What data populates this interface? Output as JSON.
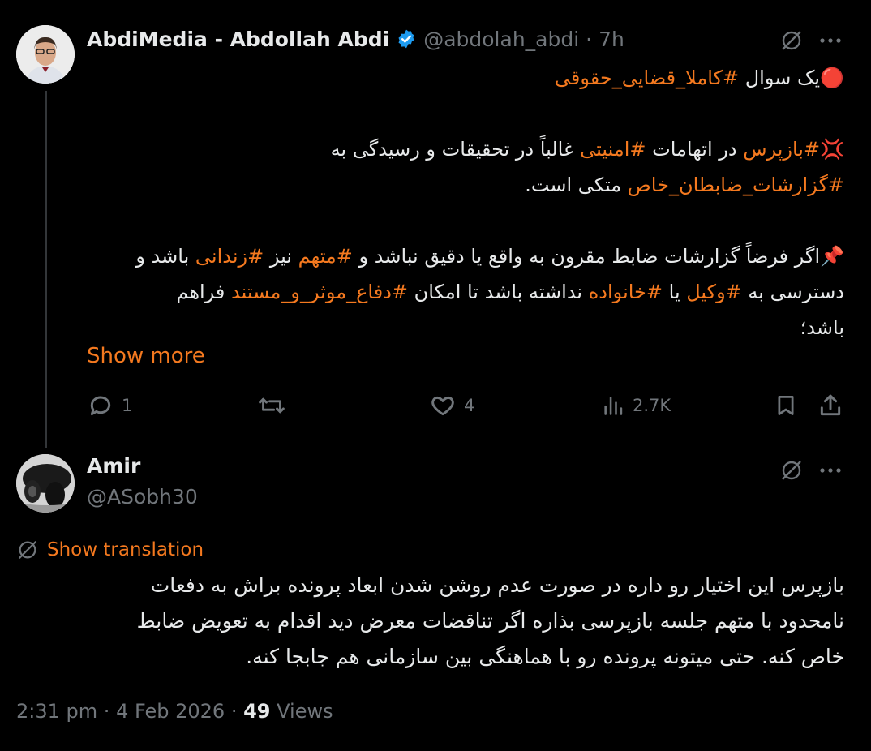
{
  "tweet": {
    "display_name": "AbdiMedia - Abdollah Abdi",
    "handle": "@abdolah_abdi",
    "separator": "·",
    "time": "7h",
    "verified": true,
    "lines": [
      {
        "segments": [
          {
            "t": "🔴یک سوال ",
            "h": false
          },
          {
            "t": "#کاملا_قضایی_حقوقی",
            "h": true
          }
        ]
      },
      {
        "segments": []
      },
      {
        "segments": [
          {
            "t": "💢",
            "h": false
          },
          {
            "t": "#بازپرس",
            "h": true
          },
          {
            "t": " در اتهامات ",
            "h": false
          },
          {
            "t": "#امنیتی",
            "h": true
          },
          {
            "t": " غالباً در تحقیقات و رسیدگی به",
            "h": false
          }
        ]
      },
      {
        "segments": [
          {
            "t": "#گزارشات_ضابطان_خاص",
            "h": true
          },
          {
            "t": " متکی است.",
            "h": false
          }
        ]
      },
      {
        "segments": []
      },
      {
        "segments": [
          {
            "t": "📌اگر فرضاً گزارشات ضابط مقرون به واقع یا دقیق نباشد و ",
            "h": false
          },
          {
            "t": "#متهم",
            "h": true
          },
          {
            "t": " نیز ",
            "h": false
          },
          {
            "t": "#زندانی",
            "h": true
          },
          {
            "t": " باشد و",
            "h": false
          }
        ]
      },
      {
        "segments": [
          {
            "t": "دسترسی به ",
            "h": false
          },
          {
            "t": "#وکیل",
            "h": true
          },
          {
            "t": " یا ",
            "h": false
          },
          {
            "t": "#خانواده",
            "h": true
          },
          {
            "t": " نداشته باشد تا امکان ",
            "h": false
          },
          {
            "t": "#دفاع_موثر_و_مستند",
            "h": true
          },
          {
            "t": " فراهم",
            "h": false
          }
        ]
      },
      {
        "segments": [
          {
            "t": "باشد؛",
            "h": false
          }
        ]
      }
    ],
    "show_more": "Show more",
    "actions": {
      "replies": "1",
      "retweets": "",
      "likes": "4",
      "views": "2.7K"
    }
  },
  "reply": {
    "display_name": "Amir",
    "handle": "@ASobh30",
    "show_translation": "Show translation",
    "lines": [
      "بازپرس این اختیار رو داره در صورت عدم روشن شدن ابعاد پرونده براش به دفعات",
      "نامحدود با متهم جلسه بازپرسی بذاره اگر تناقضات معرض دید اقدام به تعویض ضابط",
      "خاص کنه. حتی میتونه پرونده رو با هماهنگی بین سازمانی هم جابجا کنه."
    ],
    "meta": {
      "time": "2:31 pm",
      "date": "4 Feb 2026",
      "sep": "·",
      "views_count": "49",
      "views_label": "Views"
    }
  },
  "colors": {
    "hashtag": "#f4791f",
    "verified": "#1d9bf0",
    "muted": "#71767b"
  }
}
